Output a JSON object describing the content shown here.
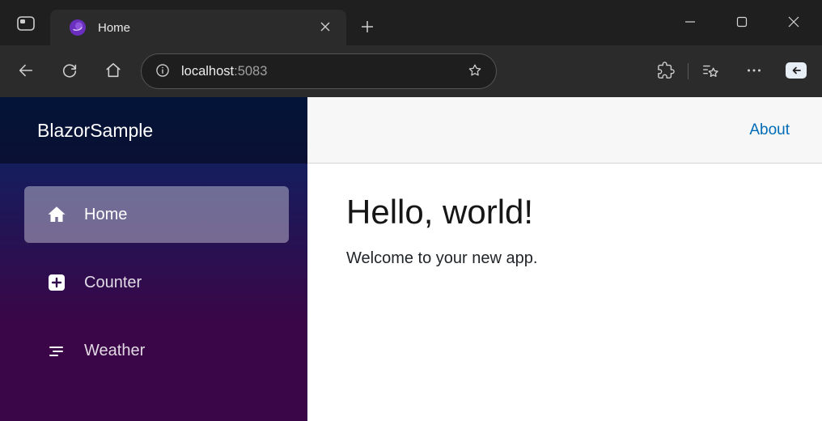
{
  "browser": {
    "tab_title": "Home",
    "url_host": "localhost",
    "url_port": ":5083"
  },
  "app": {
    "brand": "BlazorSample",
    "nav": [
      {
        "label": "Home",
        "active": true
      },
      {
        "label": "Counter",
        "active": false
      },
      {
        "label": "Weather",
        "active": false
      }
    ],
    "about_label": "About",
    "main": {
      "heading": "Hello, world!",
      "welcome": "Welcome to your new app."
    }
  },
  "colors": {
    "sidebar_gradient_top": "#052767",
    "sidebar_gradient_bottom": "#3a0647",
    "active_nav_bg": "rgba(255,255,255,0.37)",
    "link_blue": "#006bb7"
  },
  "icons": [
    "tab-actions-icon",
    "blazor-favicon-icon",
    "tab-close-icon",
    "new-tab-icon",
    "minimize-icon",
    "maximize-icon",
    "close-icon",
    "back-icon",
    "refresh-icon",
    "home-icon",
    "page-info-icon",
    "favorite-star-icon",
    "extensions-icon",
    "favorites-bar-icon",
    "more-options-icon",
    "copilot-sidebar-icon",
    "house-icon",
    "plus-square-icon",
    "list-icon"
  ]
}
